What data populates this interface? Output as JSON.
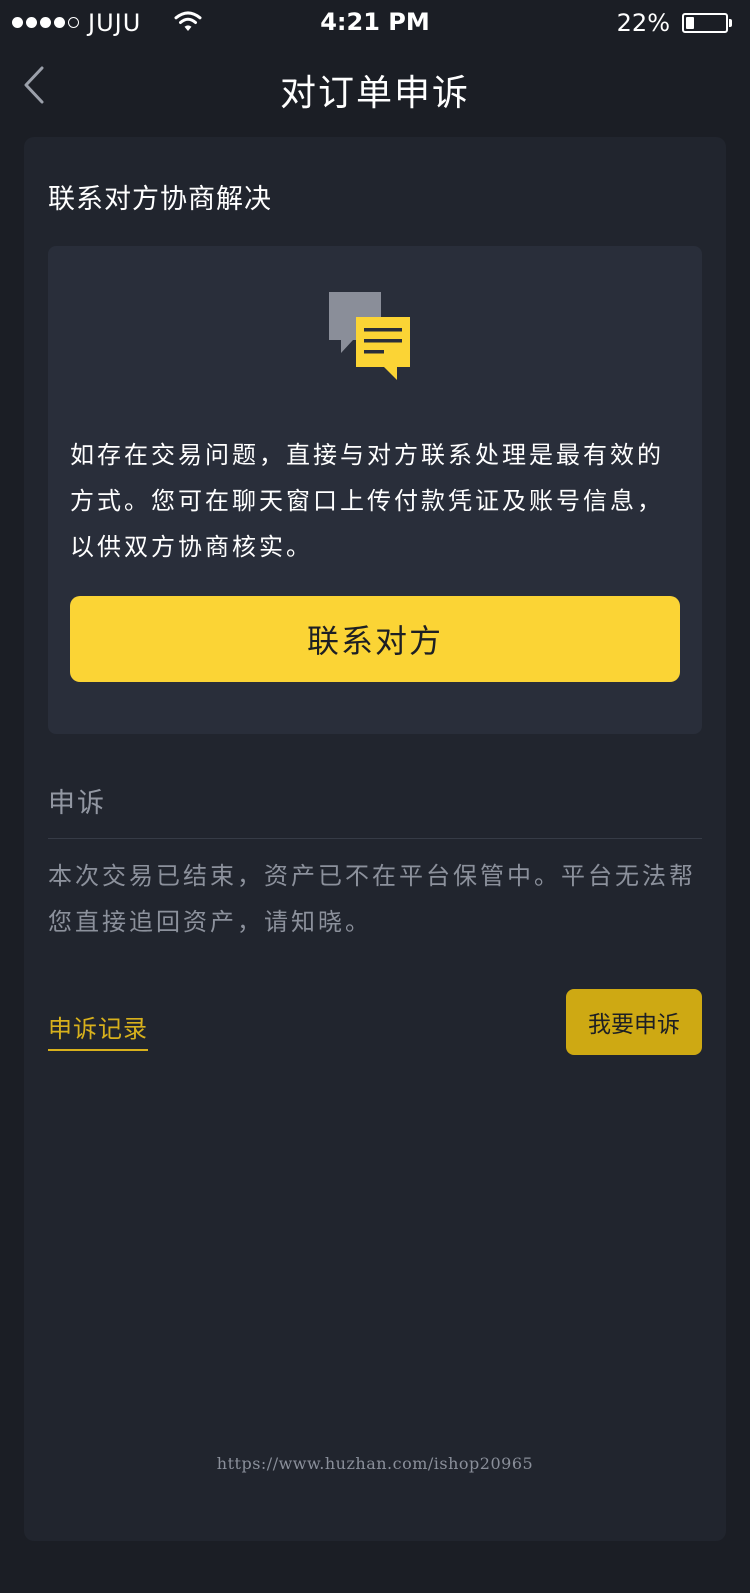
{
  "status_bar": {
    "carrier": "JUJU",
    "time": "4:21 PM",
    "battery": "22%",
    "battery_level": 0.22
  },
  "nav": {
    "title": "对订单申诉"
  },
  "contact_section": {
    "title": "联系对方协商解决",
    "description": "如存在交易问题，直接与对方联系处理是最有效的方式。您可在聊天窗口上传付款凭证及账号信息，以供双方协商核实。",
    "button_label": "联系对方"
  },
  "appeal_section": {
    "title": "申诉",
    "notice": "本次交易已结束，资产已不在平台保管中。平台无法帮您直接追回资产，请知晓。",
    "record_link": "申诉记录",
    "appeal_button": "我要申诉"
  },
  "footer": {
    "watermark": "https://www.huzhan.com/ishop20965"
  },
  "colors": {
    "background": "#1b1e25",
    "card": "#21252e",
    "inner_card": "#292e3a",
    "accent_yellow": "#fbd435",
    "dark_yellow": "#cea913",
    "link_yellow": "#d8b11c"
  }
}
